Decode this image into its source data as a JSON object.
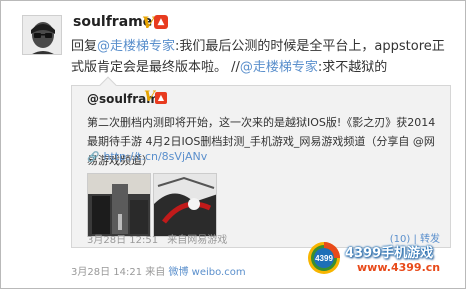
{
  "post": {
    "author": "soulframe",
    "verified_mark": "V",
    "level_badge": "▲",
    "reply_prefix": "回复",
    "mention_1": "@走楼梯专家",
    "text_1": ":我们最后公测的时候是全平台上，appstore正式版肯定会是最终版本啦。 //",
    "mention_2": "@走楼梯专家",
    "text_2": ":求不越狱的",
    "meta": {
      "date": "3月28日 14:21",
      "source_prefix": "来自",
      "source": "微博 weibo.com"
    }
  },
  "repost": {
    "author": "@soulframe",
    "verified_mark": "V",
    "level_badge": "▲",
    "text": "第二次删档内测即将开始，这一次来的是越狱IOS版!《影之刃》获2014最期待手游 4月2日IOS删档封测_手机游戏_网易游戏频道（分享自 @网易游戏频道）",
    "link": "http://t.cn/8sVjANv",
    "link_icon": "link-icon",
    "meta": {
      "date": "3月28日 12:51",
      "separator": "",
      "source_prefix": "来自",
      "source": "网易游戏"
    },
    "actions": {
      "like": "(10)",
      "separator": "|",
      "repost": "转发"
    }
  },
  "watermark": {
    "logo_text": "4399",
    "title": "4399手机游戏",
    "url": "www.4399.cn"
  },
  "colors": {
    "link_blue": "#5a8fcc",
    "verified_gold": "#e8a400",
    "badge_red": "#e83b1f",
    "repost_bg": "#f2f2f2",
    "meta_gray": "#999999"
  }
}
